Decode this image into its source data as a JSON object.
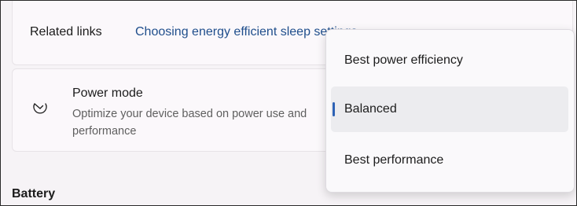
{
  "related_links": {
    "label": "Related links",
    "link_text": "Choosing energy efficient sleep settings"
  },
  "power_mode": {
    "title": "Power mode",
    "description": "Optimize your device based on power use and performance",
    "icon": "gauge-icon"
  },
  "battery_section": {
    "title": "Battery"
  },
  "dropdown": {
    "selected_value": "Balanced",
    "options": [
      {
        "label": "Best power efficiency"
      },
      {
        "label": "Balanced"
      },
      {
        "label": "Best performance"
      }
    ]
  },
  "colors": {
    "accent": "#2d62b5",
    "link": "#1f4e8c"
  }
}
